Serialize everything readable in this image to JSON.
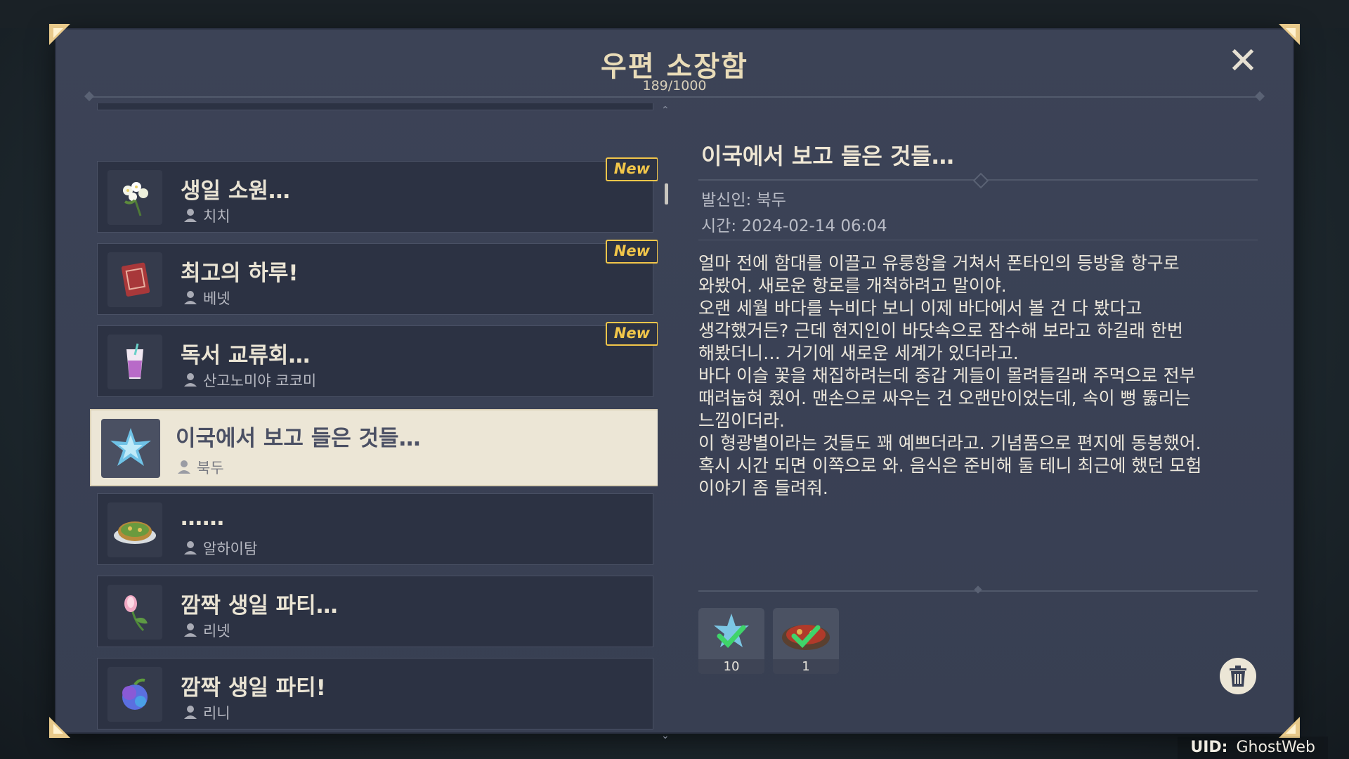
{
  "header": {
    "title": "우편 소장함",
    "count": "189/1000"
  },
  "mail_list": [
    {
      "subject": "생일 소원…",
      "sender": "치치",
      "new_label": "New",
      "icon": "flower-bouquet-icon"
    },
    {
      "subject": "최고의 하루!",
      "sender": "베넷",
      "new_label": "New",
      "icon": "red-book-icon"
    },
    {
      "subject": "독서 교류회…",
      "sender": "산고노미야 코코미",
      "new_label": "New",
      "icon": "purple-drink-icon"
    },
    {
      "subject": "이국에서 보고 들은 것들…",
      "sender": "북두",
      "icon": "starconch-icon"
    },
    {
      "subject": "……",
      "sender": "알하이탐",
      "icon": "food-plate-icon"
    },
    {
      "subject": "깜짝 생일 파티…",
      "sender": "리넷",
      "icon": "pink-flower-icon"
    },
    {
      "subject": "깜짝 생일 파티!",
      "sender": "리니",
      "icon": "blue-fruit-icon"
    }
  ],
  "detail": {
    "subject": "이국에서 보고 들은 것들…",
    "sender_line": "발신인: 북두",
    "time_line": "시간: 2024-02-14 06:04",
    "body": [
      "얼마 전에 함대를 이끌고 유룽항을 거쳐서 폰타인의 등방울 항구로",
      "와봤어. 새로운 항로를 개척하려고 말이야.",
      "오랜 세월 바다를 누비다 보니 이제 바다에서 볼 건 다 봤다고",
      "생각했거든? 근데 현지인이 바닷속으로 잠수해 보라고 하길래 한번",
      "해봤더니… 거기에 새로운 세계가 있더라고.",
      "바다 이슬 꽃을 채집하려는데 중갑 게들이 몰려들길래 주먹으로 전부",
      "때려눕혀 줬어. 맨손으로 싸우는 건 오랜만이었는데, 속이 뻥 뚫리는",
      "느낌이더라.",
      "이 형광별이라는 것들도 꽤 예쁘더라고. 기념품으로 편지에 동봉했어.",
      "혹시 시간 되면 이쪽으로 와. 음식은 준비해 둘 테니 최근에 했던 모험",
      "이야기 좀 들려줘."
    ],
    "attachments": [
      {
        "icon": "starconch-icon",
        "quantity": "10",
        "claimed": true
      },
      {
        "icon": "dish-icon",
        "quantity": "1",
        "claimed": true
      }
    ]
  },
  "uid": {
    "label": "UID:",
    "value": "GhostWeb"
  },
  "colors": {
    "panel": "#3a4155",
    "card": "#2c3243",
    "selected": "#ece6d6",
    "accent": "#f2c64a",
    "title": "#e9dcb8"
  }
}
